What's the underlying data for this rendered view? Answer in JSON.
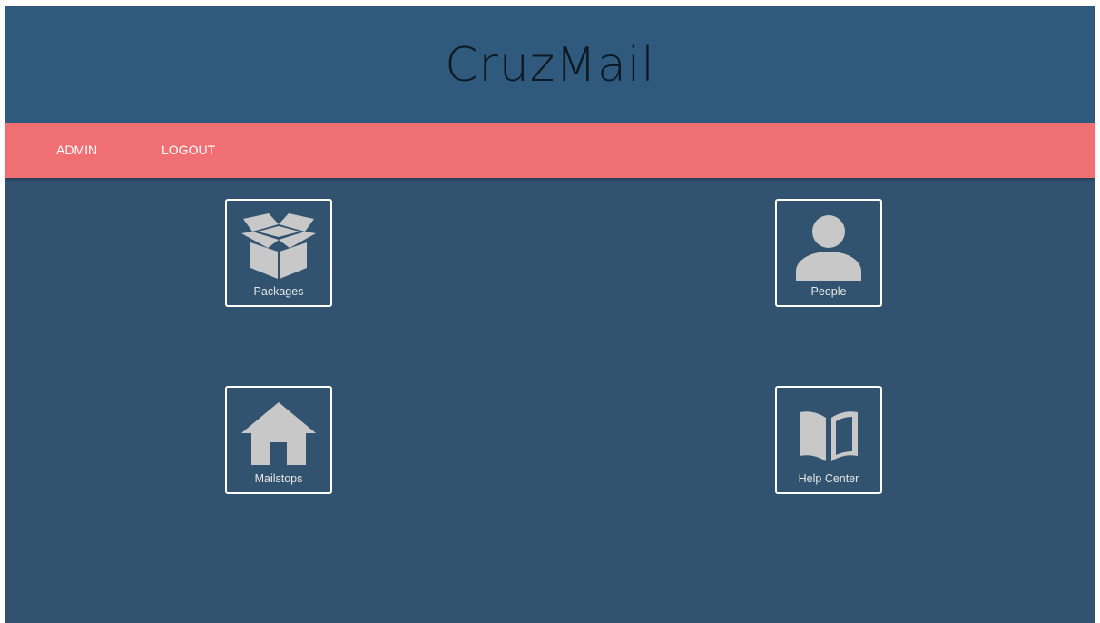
{
  "header": {
    "title": "CruzMail"
  },
  "nav": {
    "items": [
      {
        "label": "ADMIN"
      },
      {
        "label": "LOGOUT"
      }
    ]
  },
  "tiles": [
    {
      "label": "Packages",
      "icon": "box-icon"
    },
    {
      "label": "People",
      "icon": "person-icon"
    },
    {
      "label": "Mailstops",
      "icon": "house-icon"
    },
    {
      "label": "Help Center",
      "icon": "book-icon"
    }
  ],
  "colors": {
    "header_bg": "#2f5a7e",
    "page_bg": "#31536f",
    "nav_bg": "#ef6f72",
    "title_text": "#0c1822",
    "icon_fill": "#c8c8c8",
    "tile_border": "#ffffff"
  }
}
